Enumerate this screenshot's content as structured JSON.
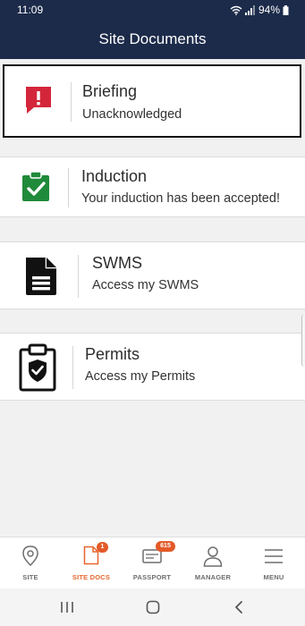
{
  "status": {
    "time": "11:09",
    "battery": "94%"
  },
  "header": {
    "title": "Site Documents"
  },
  "cards": [
    {
      "title": "Briefing",
      "subtitle": "Unacknowledged",
      "icon": "alert-speech-icon",
      "color": "#d3263a"
    },
    {
      "title": "Induction",
      "subtitle": "Your induction has been accepted!",
      "icon": "clipboard-check-icon",
      "color": "#1f8a3a"
    },
    {
      "title": "SWMS",
      "subtitle": "Access my SWMS",
      "icon": "document-icon",
      "color": "#111111"
    },
    {
      "title": "Permits",
      "subtitle": "Access my Permits",
      "icon": "clipboard-shield-icon",
      "color": "#111111"
    }
  ],
  "tabs": [
    {
      "label": "SITE",
      "icon": "location-pin-icon"
    },
    {
      "label": "SITE DOCS",
      "icon": "document-icon",
      "badge": "1",
      "active": true
    },
    {
      "label": "PASSPORT",
      "icon": "id-card-icon",
      "badge": "615"
    },
    {
      "label": "MANAGER",
      "icon": "person-icon"
    },
    {
      "label": "MENU",
      "icon": "hamburger-icon"
    }
  ],
  "colors": {
    "header_bg": "#1c2b4a",
    "accent": "#e8662e",
    "badge": "#e35a28"
  }
}
